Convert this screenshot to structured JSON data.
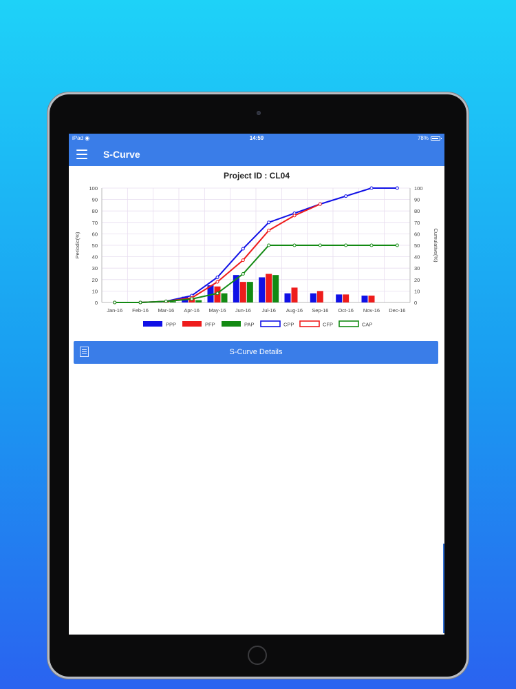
{
  "status_bar": {
    "device": "iPad",
    "time": "14:59",
    "battery": "78%"
  },
  "app_bar": {
    "title": "S-Curve"
  },
  "details_button": {
    "label": "S-Curve Details"
  },
  "colors": {
    "primary": "#3a7de8",
    "ppp": "#1010e6",
    "pfp": "#ee1c1c",
    "pap": "#138a13"
  },
  "icons": [
    "menu-icon",
    "wifi-icon",
    "battery-icon",
    "list-icon"
  ],
  "chart_data": {
    "type": "bar",
    "title": "Project ID :  CL04",
    "ylabel": "Periodic(%)",
    "y2label": "Cumulative(%)",
    "ylim": [
      0,
      100
    ],
    "y2lim": [
      0,
      100
    ],
    "yticks": [
      0,
      10,
      20,
      30,
      40,
      50,
      60,
      70,
      80,
      90,
      100
    ],
    "categories": [
      "Jan-16",
      "Feb-16",
      "Mar-16",
      "Apr-16",
      "May-16",
      "Jun-16",
      "Jul-16",
      "Aug-16",
      "Sep-16",
      "Oct-16",
      "Nov-16",
      "Dec-16"
    ],
    "grid": true,
    "legend_position": "bottom",
    "series": [
      {
        "name": "PPP",
        "kind": "bar",
        "axis": "left",
        "color": "#1010e6",
        "values": [
          0,
          0,
          1,
          5,
          15,
          24,
          22,
          8,
          8,
          7,
          6,
          0
        ]
      },
      {
        "name": "PFP",
        "kind": "bar",
        "axis": "left",
        "color": "#ee1c1c",
        "values": [
          0,
          0,
          1,
          3,
          14,
          18,
          25,
          13,
          10,
          7,
          6,
          0
        ]
      },
      {
        "name": "PAP",
        "kind": "bar",
        "axis": "left",
        "color": "#138a13",
        "values": [
          0,
          0,
          1,
          2,
          8,
          18,
          24,
          0,
          0,
          0,
          0,
          0
        ]
      },
      {
        "name": "CPP",
        "kind": "line",
        "axis": "right",
        "color": "#1010e6",
        "values": [
          0,
          0,
          1,
          6,
          22,
          47,
          70,
          78,
          86,
          93,
          100,
          100
        ]
      },
      {
        "name": "CFP",
        "kind": "line",
        "axis": "right",
        "color": "#ee1c1c",
        "values": [
          0,
          0,
          1,
          4,
          18,
          37,
          63,
          76,
          86,
          null,
          null,
          null
        ]
      },
      {
        "name": "CAP",
        "kind": "line",
        "axis": "right",
        "color": "#138a13",
        "values": [
          0,
          0,
          1,
          3,
          8,
          25,
          50,
          50,
          50,
          50,
          50,
          50
        ]
      }
    ]
  }
}
